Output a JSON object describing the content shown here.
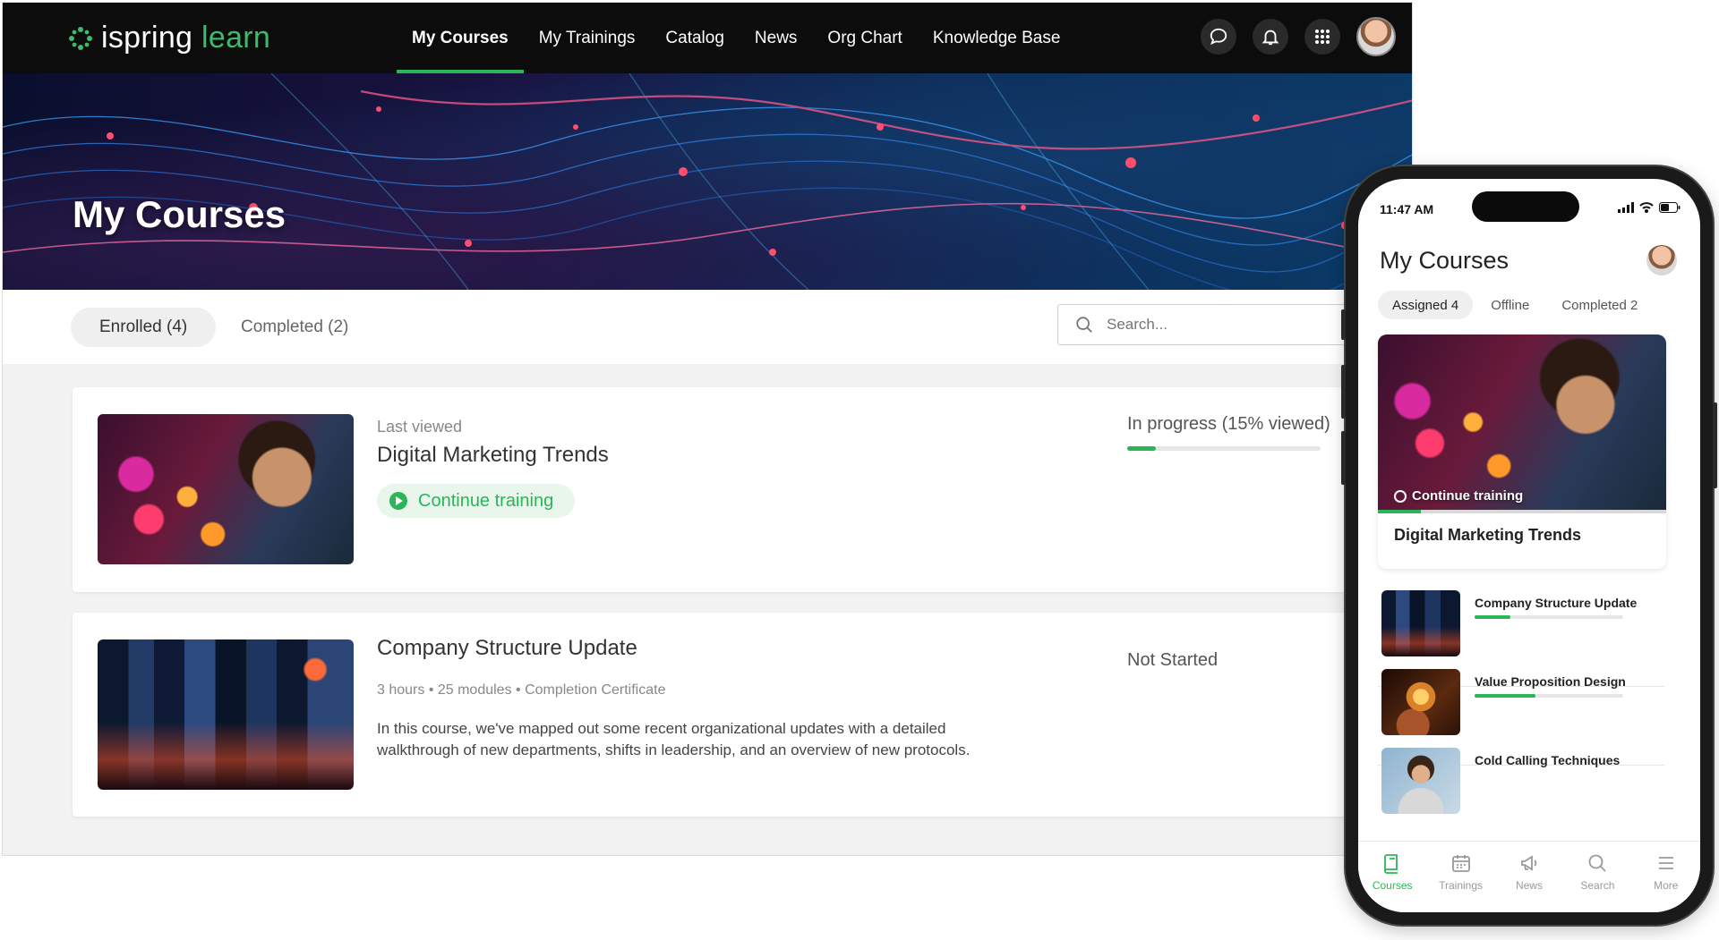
{
  "brand": {
    "name_a": "ispring",
    "name_b": "learn",
    "accent": "#2bb559"
  },
  "nav": {
    "items": [
      "My Courses",
      "My Trainings",
      "Catalog",
      "News",
      "Org Chart",
      "Knowledge Base"
    ],
    "active": "My Courses",
    "icons": [
      "chat-icon",
      "bell-icon",
      "apps-grid-icon",
      "user-avatar"
    ]
  },
  "hero": {
    "title": "My Courses"
  },
  "tabs": {
    "enrolled": "Enrolled (4)",
    "completed": "Completed (2)",
    "active": "enrolled"
  },
  "search": {
    "placeholder": "Search..."
  },
  "courses": [
    {
      "label": "Last viewed",
      "title": "Digital Marketing Trends",
      "button": "Continue training",
      "status": "In progress (15% viewed)",
      "progress": 0.15
    },
    {
      "title": "Company Structure Update",
      "meta": "3 hours • 25 modules  •  Completion Certificate",
      "description": "In this course, we've mapped out some recent organizational updates with a detailed walkthrough of new departments, shifts in leadership, and an overview of new protocols.",
      "status": "Not Started"
    }
  ],
  "phone": {
    "time": "11:47 AM",
    "title": "My Courses",
    "tabs": [
      "Assigned 4",
      "Offline",
      "Completed 2"
    ],
    "featured": {
      "button": "Continue training",
      "title": "Digital Marketing Trends",
      "progress": 0.15
    },
    "items": [
      {
        "title": "Company Structure Update",
        "progress": 0.24
      },
      {
        "title": "Value Proposition Design",
        "progress": 0.41
      },
      {
        "title": "Cold Calling Techniques"
      }
    ],
    "bottom_nav": [
      "Courses",
      "Trainings",
      "News",
      "Search",
      "More"
    ],
    "bottom_active": "Courses"
  }
}
